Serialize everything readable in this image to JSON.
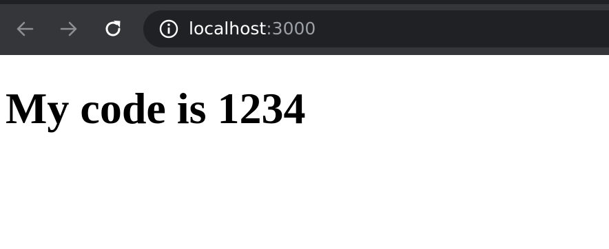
{
  "browser": {
    "nav": {
      "back_icon": "arrow-left-icon",
      "forward_icon": "arrow-right-icon",
      "reload_icon": "reload-icon"
    },
    "address_bar": {
      "info_icon": "info-circle-icon",
      "host": "localhost",
      "port": ":3000"
    },
    "colors": {
      "toolbar": "#35363a",
      "omnibox": "#202124",
      "disabled_icon": "#8e8f93",
      "active_icon": "#ffffff",
      "port_text": "#9aa0a6"
    }
  },
  "page": {
    "heading": "My code is 1234"
  }
}
